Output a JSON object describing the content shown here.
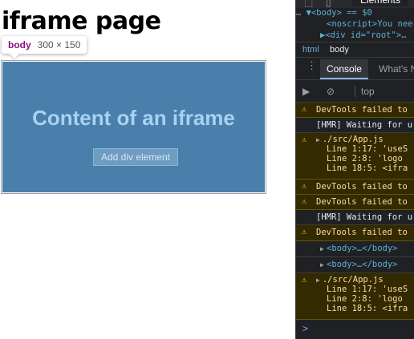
{
  "page": {
    "title": "iframe page",
    "tooltip": {
      "tag": "body",
      "dimensions": "300 × 150"
    },
    "iframe": {
      "heading": "Content of an iframe",
      "button_label": "Add div element"
    },
    "colors": {
      "iframe_bg": "#4a7fab",
      "iframe_text": "#a8d2f2",
      "tooltip_tag": "#881280"
    }
  },
  "devtools": {
    "tabs": {
      "elements_label": "Elements",
      "inspect_icon": "inspect-element-icon",
      "device_icon": "device-toolbar-icon"
    },
    "code_lines": [
      "▼<body> == $0",
      "<noscript>You nee",
      "▶<div id=\"root\">…"
    ],
    "breadcrumbs": [
      "html",
      "body"
    ],
    "drawer": {
      "console_label": "Console",
      "whats_new_label": "What's N"
    },
    "toolbar": {
      "context": "top",
      "sidebar_icon": "sidebar-toggle-icon",
      "clear_icon": "clear-console-icon"
    },
    "messages": [
      {
        "kind": "warn",
        "lines": [
          "DevTools failed to"
        ]
      },
      {
        "kind": "info",
        "lines": [
          "[HMR] Waiting for u"
        ]
      },
      {
        "kind": "warn",
        "lines": [
          "./src/App.js",
          "Line 1:17:  'useS",
          "Line 2:8:   'logo",
          "Line 18:5:  <ifra"
        ]
      },
      {
        "kind": "warn",
        "lines": [
          "DevTools failed to"
        ]
      },
      {
        "kind": "warn",
        "lines": [
          "DevTools failed to"
        ]
      },
      {
        "kind": "info",
        "lines": [
          "[HMR] Waiting for u"
        ]
      },
      {
        "kind": "warn",
        "lines": [
          "DevTools failed to"
        ]
      },
      {
        "kind": "node",
        "lines": [
          "<body>…</body>"
        ]
      },
      {
        "kind": "node",
        "lines": [
          "<body>…</body>"
        ]
      },
      {
        "kind": "warn",
        "lines": [
          "./src/App.js",
          "Line 1:17:  'useS",
          "Line 2:8:   'logo",
          "Line 18:5:  <ifra"
        ]
      }
    ],
    "prompt_symbol": ">"
  }
}
